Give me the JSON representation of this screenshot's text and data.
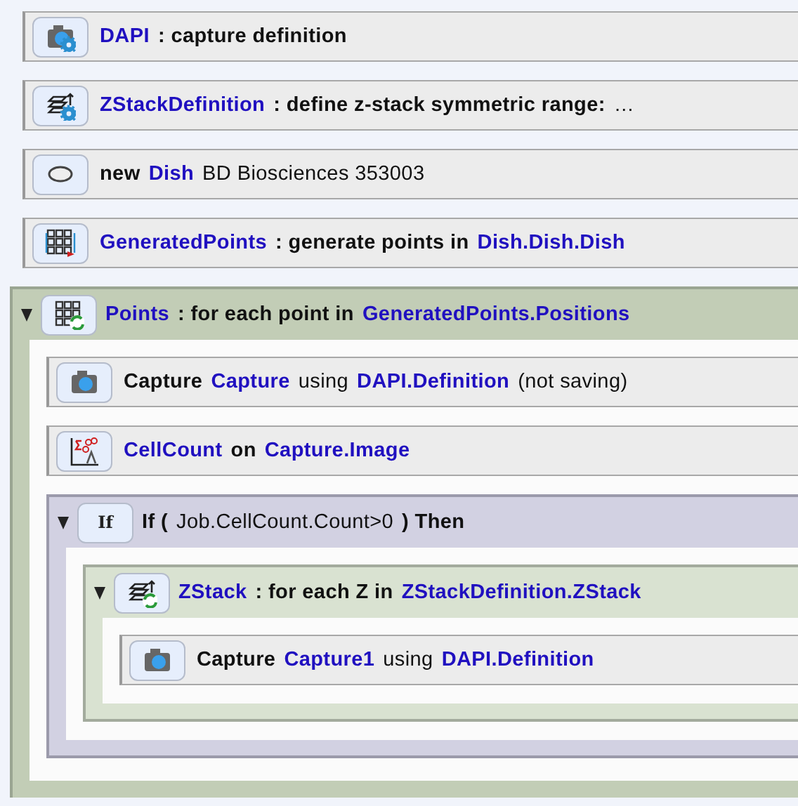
{
  "blocks": [
    {
      "kind": "capture-definition",
      "segments": [
        {
          "kind": "reference",
          "text": "DAPI"
        },
        {
          "kind": "keyword",
          "text": ": capture definition"
        }
      ]
    },
    {
      "kind": "zstack-definition",
      "segments": [
        {
          "kind": "reference",
          "text": "ZStackDefinition"
        },
        {
          "kind": "keyword",
          "text": ": define z-stack symmetric range:"
        },
        {
          "kind": "detail",
          "text": "…"
        }
      ]
    },
    {
      "kind": "dish",
      "segments": [
        {
          "kind": "keyword",
          "text": "new"
        },
        {
          "kind": "reference",
          "text": "Dish"
        },
        {
          "kind": "detail",
          "text": "BD Biosciences 353003"
        }
      ]
    },
    {
      "kind": "point-generator",
      "segments": [
        {
          "kind": "reference",
          "text": "GeneratedPoints"
        },
        {
          "kind": "keyword",
          "text": ": generate points in"
        },
        {
          "kind": "reference",
          "text": "Dish.Dish.Dish"
        }
      ]
    },
    {
      "kind": "point-loop",
      "expanded": true,
      "segments": [
        {
          "kind": "reference",
          "text": "Points"
        },
        {
          "kind": "keyword",
          "text": ": for each point in"
        },
        {
          "kind": "reference",
          "text": "GeneratedPoints.Positions"
        }
      ],
      "children": [
        {
          "kind": "capture",
          "segments": [
            {
              "kind": "keyword",
              "text": "Capture"
            },
            {
              "kind": "reference",
              "text": "Capture"
            },
            {
              "kind": "detail",
              "text": "using"
            },
            {
              "kind": "reference",
              "text": "DAPI.Definition"
            },
            {
              "kind": "detail",
              "text": "(not saving)"
            }
          ]
        },
        {
          "kind": "cell-count",
          "segments": [
            {
              "kind": "reference",
              "text": "CellCount"
            },
            {
              "kind": "keyword",
              "text": "on"
            },
            {
              "kind": "reference",
              "text": "Capture.Image"
            }
          ]
        },
        {
          "kind": "condition",
          "expanded": true,
          "badge": "If",
          "segments": [
            {
              "kind": "keyword",
              "text": "If ("
            },
            {
              "kind": "detail",
              "text": "Job.CellCount.Count>0"
            },
            {
              "kind": "keyword",
              "text": ") Then"
            }
          ],
          "children": [
            {
              "kind": "z-loop",
              "expanded": true,
              "segments": [
                {
                  "kind": "reference",
                  "text": "ZStack"
                },
                {
                  "kind": "keyword",
                  "text": ": for each Z in"
                },
                {
                  "kind": "reference",
                  "text": "ZStackDefinition.ZStack"
                }
              ],
              "children": [
                {
                  "kind": "capture",
                  "segments": [
                    {
                      "kind": "keyword",
                      "text": "Capture"
                    },
                    {
                      "kind": "reference",
                      "text": "Capture1"
                    },
                    {
                      "kind": "detail",
                      "text": "using"
                    },
                    {
                      "kind": "reference",
                      "text": "DAPI.Definition"
                    }
                  ]
                }
              ]
            }
          ]
        }
      ]
    }
  ]
}
